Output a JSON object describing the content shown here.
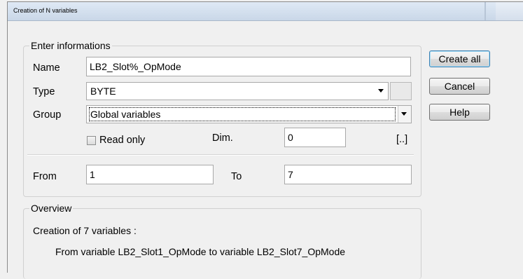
{
  "window": {
    "title": "Creation of N variables"
  },
  "enter_group": {
    "legend": "Enter informations",
    "name": {
      "label": "Name",
      "value": "LB2_Slot%_OpMode"
    },
    "type": {
      "label": "Type",
      "value": "BYTE"
    },
    "group": {
      "label": "Group",
      "value": "Global variables"
    },
    "read_only": {
      "label": "Read only",
      "checked": false
    },
    "dim": {
      "label": "Dim.",
      "value": "0",
      "browse": "[..]"
    },
    "from": {
      "label": "From",
      "value": "1"
    },
    "to": {
      "label": "To",
      "value": "7"
    }
  },
  "overview": {
    "legend": "Overview",
    "line1": "Creation of 7 variables :",
    "line2": "From variable LB2_Slot1_OpMode to variable LB2_Slot7_OpMode"
  },
  "buttons": {
    "create_all": "Create all",
    "cancel": "Cancel",
    "help": "Help"
  },
  "colors": {
    "default_button_border": "#3c7fb1",
    "title_bar": "#dfe9f5"
  }
}
